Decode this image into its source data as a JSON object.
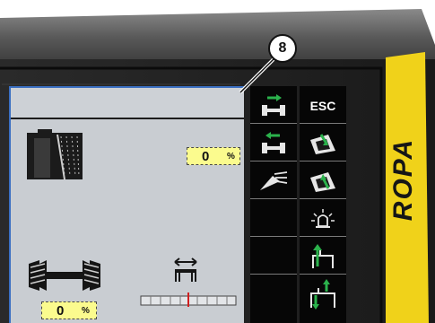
{
  "brand": {
    "text": "ROPA",
    "color": "#f0d21a"
  },
  "callout": {
    "number": "8"
  },
  "display": {
    "level_percent": {
      "value": "0",
      "unit": "%"
    },
    "axle_percent": {
      "value": "0",
      "unit": "%"
    },
    "colors": {
      "screen": "#c9cdd2",
      "highlight": "#fbfb8e",
      "frame": "#3a6fc2"
    }
  },
  "buttons": {
    "left": [
      {
        "name": "axle-green-arrow-right",
        "icon": "axle-arrow-right-icon"
      },
      {
        "name": "axle-green-arrow-left",
        "icon": "axle-arrow-left-icon"
      },
      {
        "name": "light-beam",
        "icon": "work-light-icon"
      },
      {
        "name": "blank-1",
        "icon": ""
      },
      {
        "name": "blank-2",
        "icon": ""
      },
      {
        "name": "blank-3",
        "icon": ""
      }
    ],
    "right": [
      {
        "name": "esc",
        "label": "ESC"
      },
      {
        "name": "tank-arrow-down",
        "icon": "tank-arrow-down-icon"
      },
      {
        "name": "tank-arrow-up",
        "icon": "tank-arrow-up-icon"
      },
      {
        "name": "beacon",
        "icon": "beacon-light-icon"
      },
      {
        "name": "hatch-up",
        "icon": "hatch-open-icon"
      },
      {
        "name": "hatch-up-down",
        "icon": "hatch-updown-icon"
      }
    ]
  }
}
